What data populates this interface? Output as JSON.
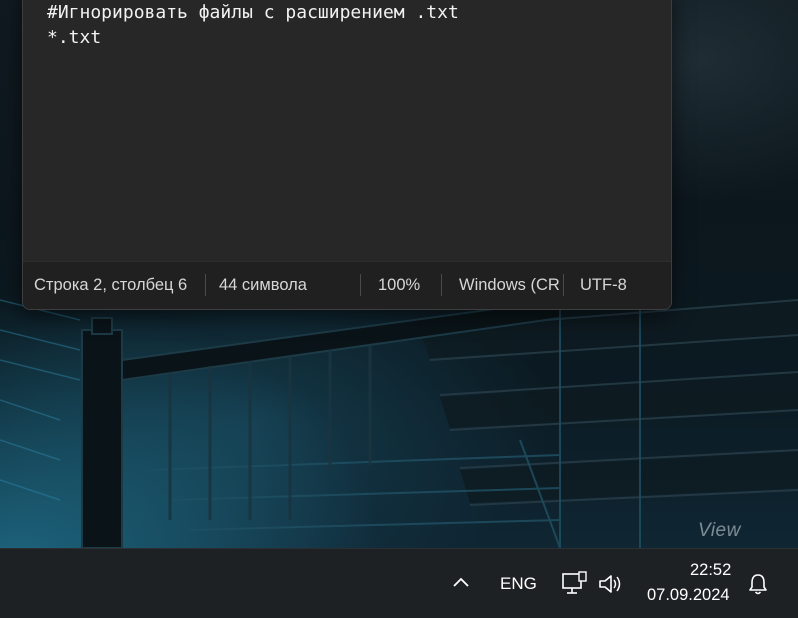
{
  "editor": {
    "lines": [
      "#Игнорировать файлы с расширением .txt",
      "*.txt"
    ]
  },
  "statusbar": {
    "cursor_position": "Строка 2, столбец 6",
    "char_count": "44 символа",
    "zoom": "100%",
    "line_ending": "Windows (CRLF)",
    "encoding": "UTF-8"
  },
  "taskbar": {
    "show_hidden_icons": "chevron-up-icon",
    "language": "ENG",
    "network": "network-icon",
    "volume": "speaker-icon",
    "time": "22:52",
    "date": "07.09.2024",
    "notifications": "bell-icon"
  },
  "desktop": {
    "watermark": "View"
  }
}
